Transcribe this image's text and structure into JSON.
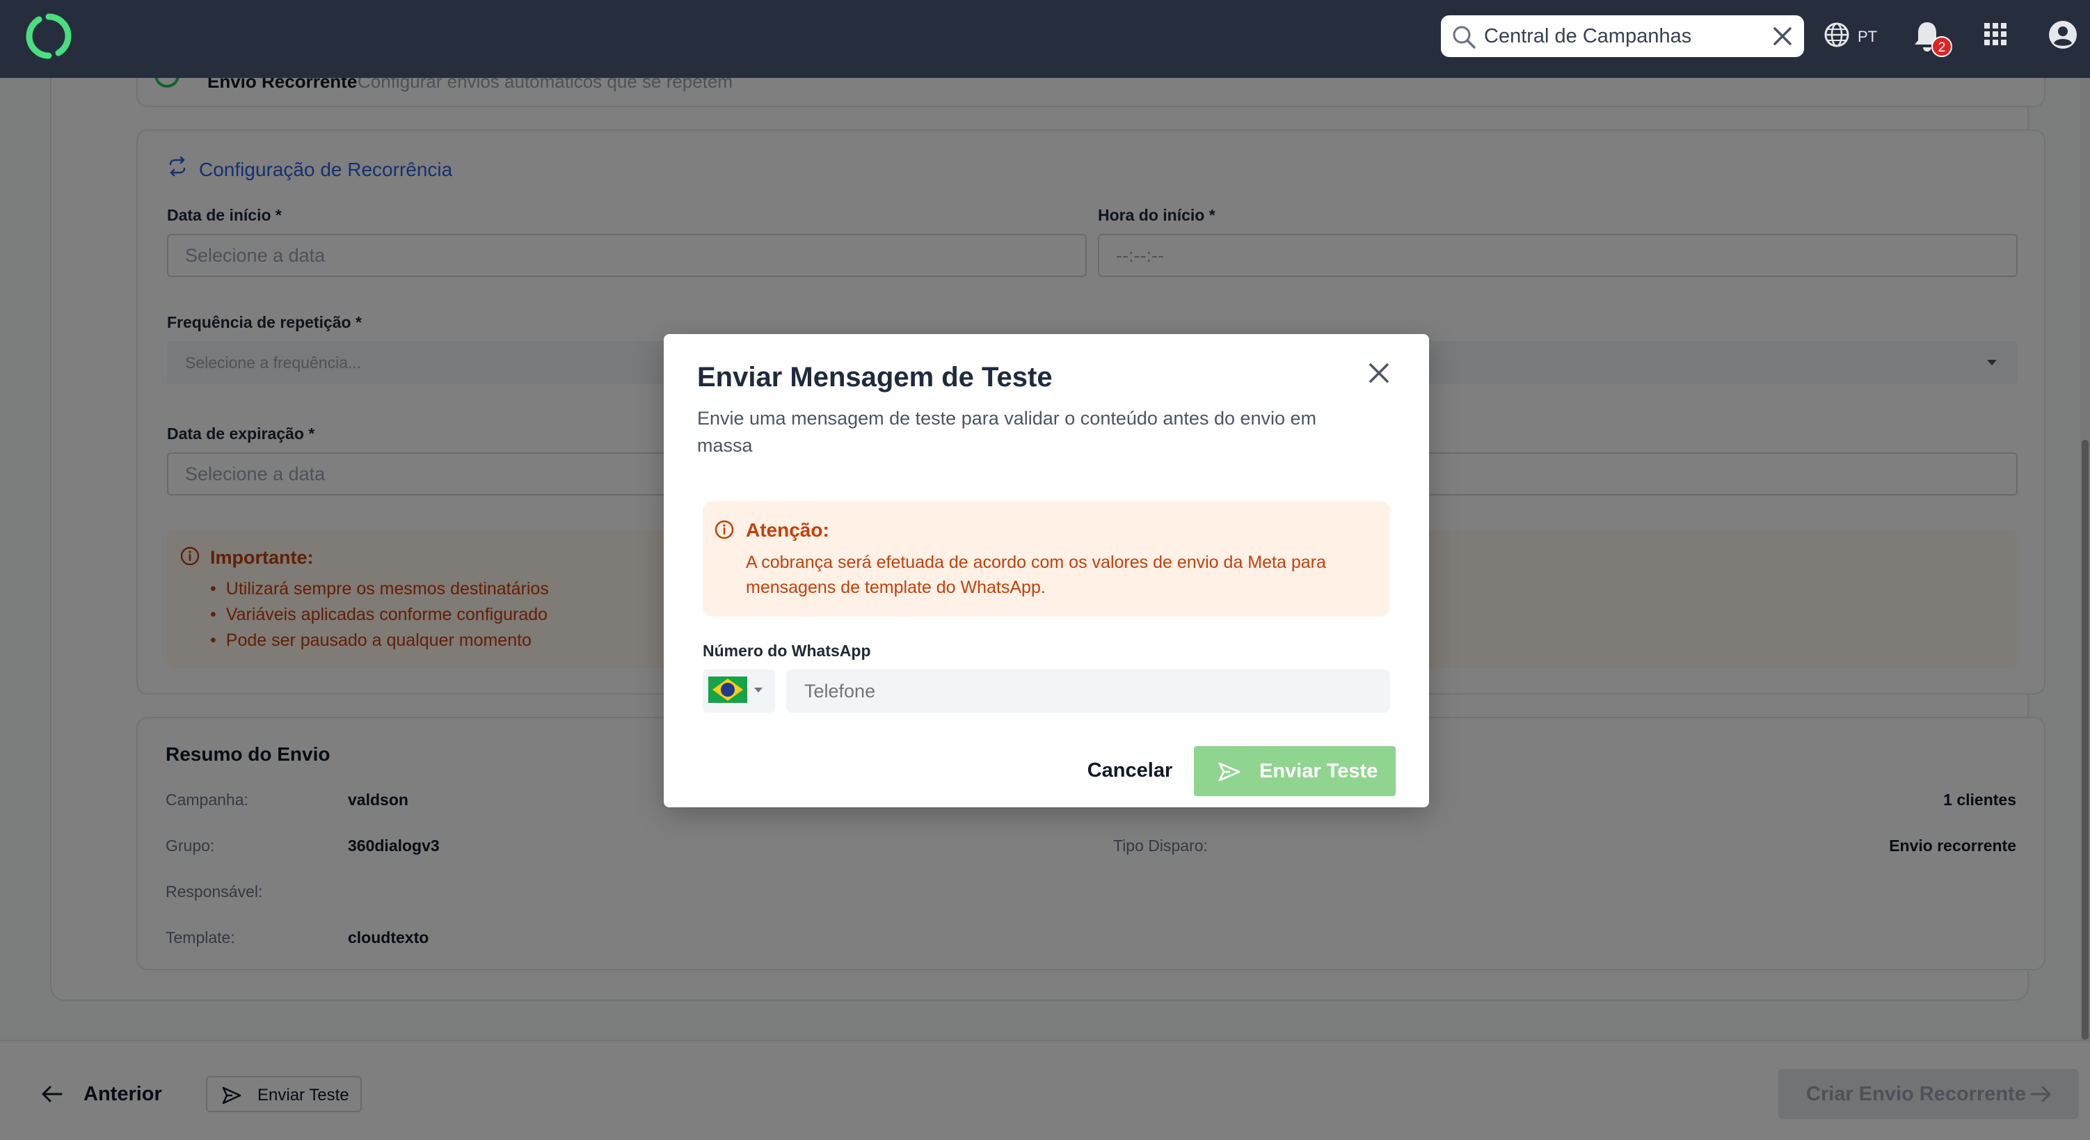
{
  "topbar": {
    "search_value": "Central de Campanhas",
    "lang_label": "PT",
    "notification_count": "2"
  },
  "previous_section": {
    "title": "Envio Recorrente",
    "subtitle": "Configurar envios automáticos que se repetem"
  },
  "recurrence": {
    "title": "Configuração de Recorrência",
    "start_date_label": "Data de início *",
    "start_date_placeholder": "Selecione a data",
    "start_time_label": "Hora do início *",
    "start_time_placeholder": "--:--:--",
    "frequency_label": "Frequência de repetição *",
    "frequency_placeholder": "Selecione a frequência...",
    "expiry_label": "Data de expiração *",
    "expiry_placeholder": "Selecione a data",
    "important_title": "Importante:",
    "important_items": [
      "Utilizará sempre os mesmos destinatários",
      "Variáveis aplicadas conforme configurado",
      "Pode ser pausado a qualquer momento"
    ]
  },
  "summary": {
    "title": "Resumo do Envio",
    "campaign_label": "Campanha:",
    "campaign_value": "valdson",
    "group_label": "Grupo:",
    "group_value": "360dialogv3",
    "responsible_label": "Responsável:",
    "template_label": "Template:",
    "template_value": "cloudtexto",
    "clients_value": "1 clientes",
    "trigger_label": "Tipo Disparo:",
    "trigger_value": "Envio recorrente"
  },
  "footer": {
    "prev_label": "Anterior",
    "test_label": "Enviar Teste",
    "create_label": "Criar Envio Recorrente"
  },
  "modal": {
    "title": "Enviar Mensagem de Teste",
    "description": "Envie uma mensagem de teste para validar o conteúdo antes do envio em massa",
    "alert_title": "Atenção:",
    "alert_text": "A cobrança será efetuada de acordo com os valores de envio da Meta para mensagens de template do WhatsApp.",
    "whatsapp_label": "Número do WhatsApp",
    "phone_placeholder": "Telefone",
    "cancel_label": "Cancelar",
    "send_label": "Enviar Teste"
  },
  "colors": {
    "topbar": "#262e3d",
    "brand_green": "#4ade80",
    "accent_blue": "#2563eb",
    "warning_text": "#c2410c",
    "send_button": "#8fd58f"
  }
}
